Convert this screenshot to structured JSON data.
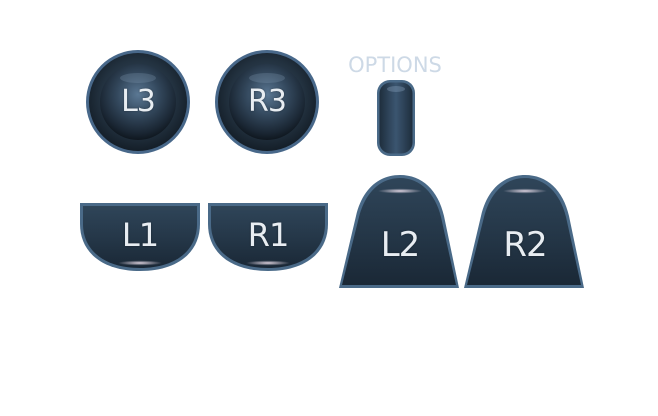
{
  "options_label": "OPTIONS",
  "buttons": {
    "l3": "L3",
    "r3": "R3",
    "l1": "L1",
    "r1": "R1",
    "l2": "L2",
    "r2": "R2"
  },
  "colors": {
    "body_dark": "#1a2735",
    "body_mid": "#2c3f52",
    "rim": "#4a6a88",
    "label": "#e8edf2",
    "options_text": "#cdd9e6",
    "background": "#ffffff"
  }
}
